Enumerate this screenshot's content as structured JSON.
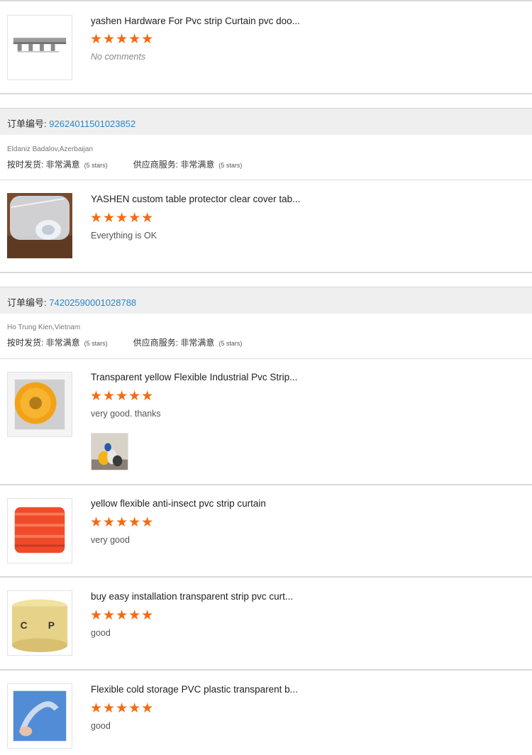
{
  "first_review": {
    "title": "yashen Hardware For Pvc strip Curtain pvc doo...",
    "stars": "★★★★★",
    "comment": "No comments"
  },
  "orders": [
    {
      "order_label": "订单编号:",
      "order_number": "92624011501023852",
      "buyer": "Eldaniz Badalov,Azerbaijan",
      "delivery_label": "按时发货: 非常满意",
      "delivery_stars": "(5 stars)",
      "service_label": "供应商服务: 非常满意",
      "service_stars": "(5 stars)",
      "items": [
        {
          "title": "YASHEN custom table protector clear cover tab...",
          "stars": "★★★★★",
          "comment": "Everything is OK"
        }
      ]
    },
    {
      "order_label": "订单编号:",
      "order_number": "74202590001028788",
      "buyer": "Ho Trung Kien,Vietnam",
      "delivery_label": "按时发货: 非常满意",
      "delivery_stars": "(5 stars)",
      "service_label": "供应商服务: 非常满意",
      "service_stars": "(5 stars)",
      "items": [
        {
          "title": "Transparent yellow Flexible Industrial Pvc Strip...",
          "stars": "★★★★★",
          "comment": "very good. thanks"
        },
        {
          "title": "yellow flexible anti-insect pvc strip curtain",
          "stars": "★★★★★",
          "comment": "very good"
        },
        {
          "title": "buy easy installation transparent strip pvc curt...",
          "stars": "★★★★★",
          "comment": "good"
        },
        {
          "title": "Flexible cold storage PVC plastic transparent b...",
          "stars": "★★★★★",
          "comment": "good"
        }
      ]
    }
  ],
  "colors": {
    "star": "#f36b12",
    "order_number": "#2a86c9",
    "order_bar": "#efefef"
  }
}
